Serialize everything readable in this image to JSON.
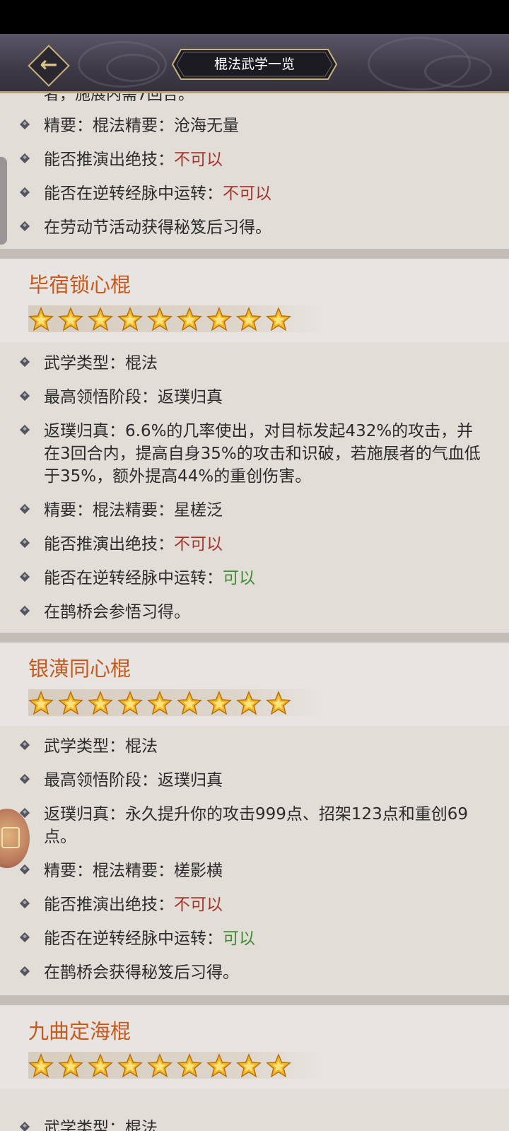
{
  "header": {
    "title": "棍法武学一览",
    "back_icon": "arrow-left-icon"
  },
  "partial_text": "者，施展内需7回合。",
  "first_block": {
    "items": [
      {
        "label": "精要：",
        "value": "棍法精要：沧海无量"
      },
      {
        "label": "能否推演出绝技：",
        "value": "不可以",
        "color": "red"
      },
      {
        "label": "能否在逆转经脉中运转：",
        "value": "不可以",
        "color": "red"
      },
      {
        "label": "",
        "value": "在劳动节活动获得秘笈后习得。"
      }
    ]
  },
  "skills": [
    {
      "name": "毕宿锁心棍",
      "stars": 9,
      "type_label": "武学类型：",
      "type_value": "棍法",
      "stage_label": "最高领悟阶段：",
      "stage_value": "返璞归真",
      "effect_label": "返璞归真：",
      "effect_value": "6.6%的几率使出，对目标发起432%的攻击，并在3回合内，提高自身35%的攻击和识破，若施展者的气血低于35%，额外提高44%的重创伤害。",
      "essence_label": "精要：",
      "essence_value": "棍法精要：星槎泛",
      "derive_label": "能否推演出绝技：",
      "derive_value": "不可以",
      "reverse_label": "能否在逆转经脉中运转：",
      "reverse_value": "可以",
      "source": "在鹊桥会参悟习得。"
    },
    {
      "name": "银潢同心棍",
      "stars": 9,
      "type_label": "武学类型：",
      "type_value": "棍法",
      "stage_label": "最高领悟阶段：",
      "stage_value": "返璞归真",
      "effect_label": "返璞归真：",
      "effect_value": "永久提升你的攻击999点、招架123点和重创69点。",
      "essence_label": "精要：",
      "essence_value": "棍法精要：槎影横",
      "derive_label": "能否推演出绝技：",
      "derive_value": "不可以",
      "reverse_label": "能否在逆转经脉中运转：",
      "reverse_value": "可以",
      "source": "在鹊桥会获得秘笈后习得。"
    },
    {
      "name": "九曲定海棍",
      "stars": 9,
      "type_partial": "武学类型：棍法"
    }
  ],
  "colors": {
    "skill_name": "#c55a1c",
    "negative": "#a3352a",
    "positive": "#3e8c2f"
  }
}
